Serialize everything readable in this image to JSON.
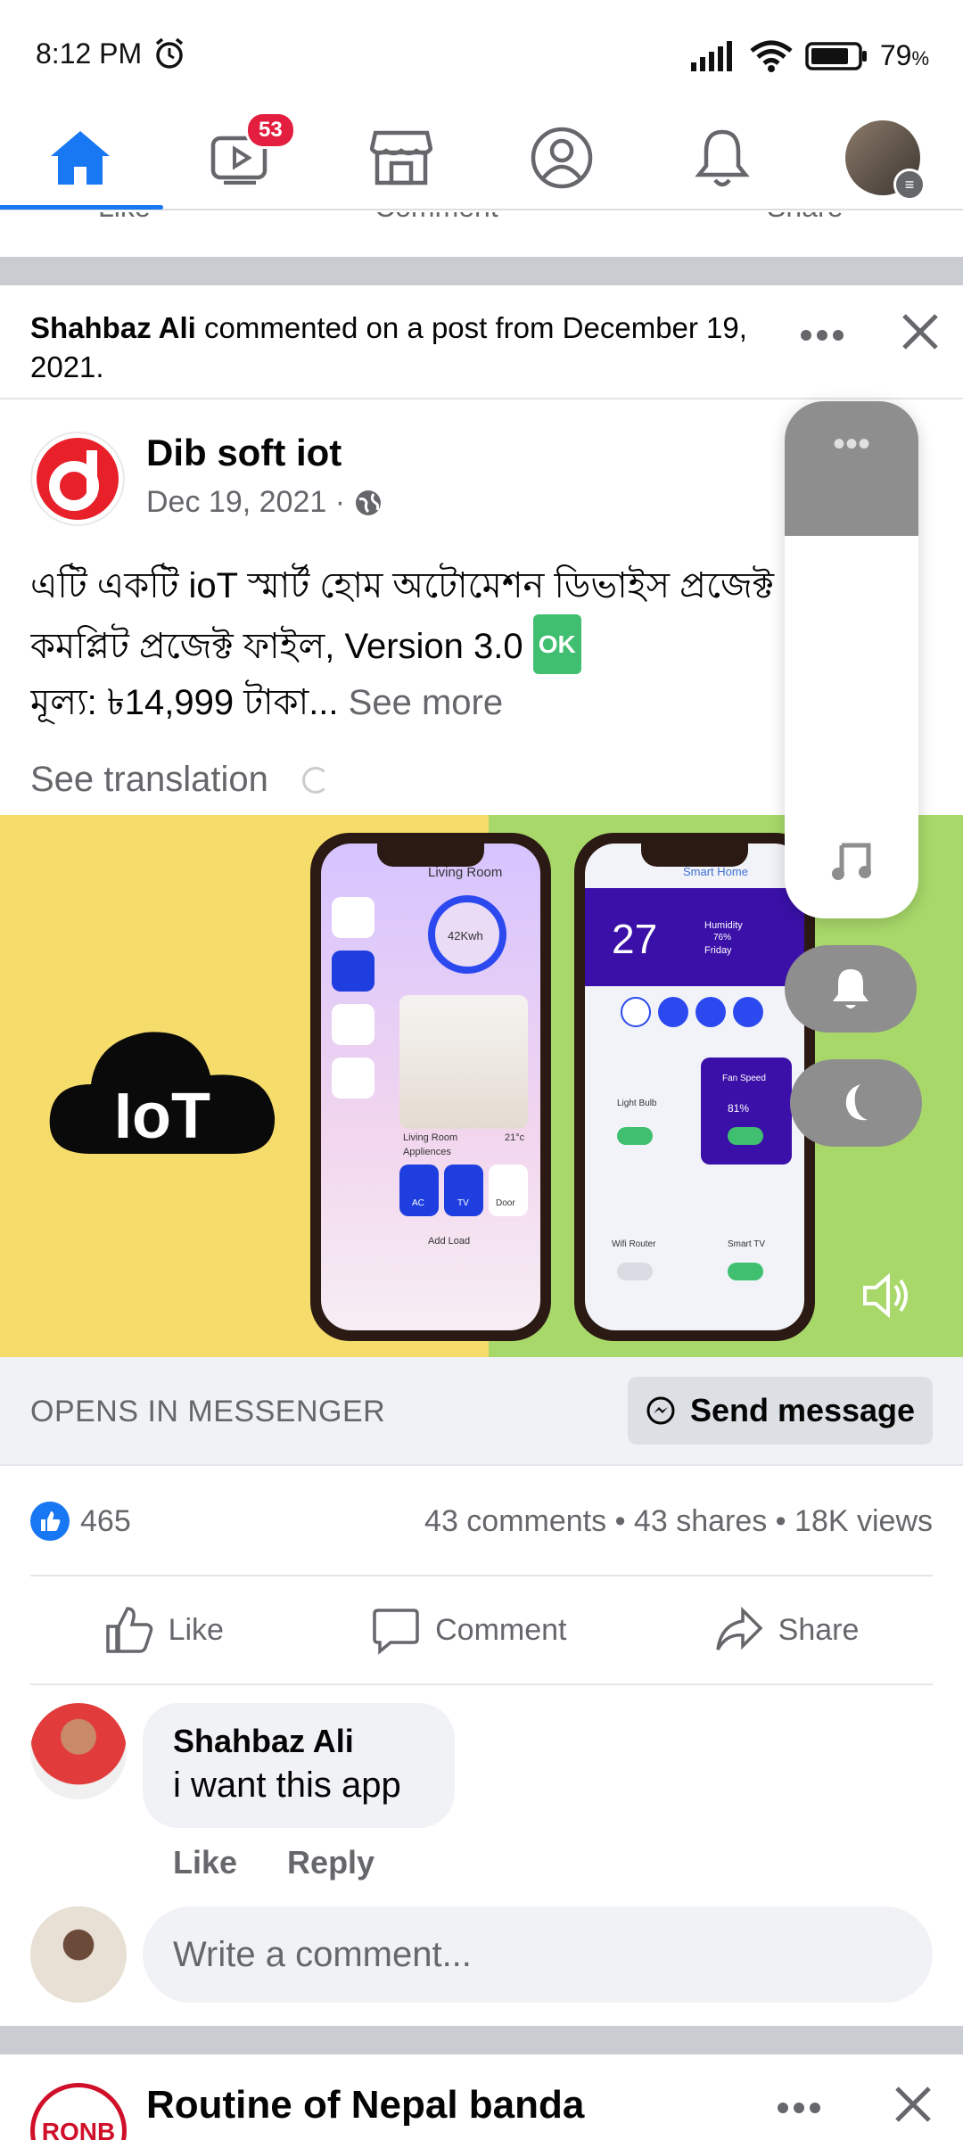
{
  "status_bar": {
    "time": "8:12 PM",
    "battery": "79",
    "battery_pct_symbol": "%"
  },
  "top_nav": {
    "video_badge": "53"
  },
  "prev_post": {
    "like": "Like",
    "comment": "Comment",
    "share": "Share"
  },
  "notice": {
    "actor": "Shahbaz Ali",
    "text": " commented on a post from December 19, 2021."
  },
  "post": {
    "page_name": "Dib soft iot",
    "date": "Dec 19, 2021 ·",
    "line1": "এটি একটি ioT স্মার্ট হোম অটোমেশন ডিভাইস প্রজেক্ট",
    "line2": "কমপ্লিট প্রজেক্ট ফাইল, Version 3.0",
    "ok_badge": "OK",
    "line3": "মূল্য: ৳14,999 টাকা...",
    "see_more": " See more",
    "see_translation": "See translation",
    "media": {
      "cloud_label": "IoT",
      "phone1": {
        "title": "Living Room",
        "power": "42Kwh",
        "room_label": "Living Room",
        "temp": "21°c",
        "appliances": "Appliences",
        "ac": "AC",
        "tv": "TV",
        "door": "Door",
        "add_load": "Add Load"
      },
      "phone2": {
        "title": "Smart Home",
        "temp": "27",
        "humidity": "Humidity",
        "humidity_value": "76%",
        "day": "Friday",
        "light_bulb": "Light Bulb",
        "fan_speed": "Fan Speed",
        "fan_value": "81%",
        "wifi_router": "Wifi Router",
        "smart_tv": "Smart TV"
      }
    },
    "cta_label": "OPENS IN MESSENGER",
    "cta_button": "Send message",
    "reaction_count": "465",
    "stats": "43 comments • 43 shares • 18K views",
    "actions": {
      "like": "Like",
      "comment": "Comment",
      "share": "Share"
    }
  },
  "comment": {
    "author": "Shahbaz Ali",
    "text": "i want this app",
    "like": "Like",
    "reply": "Reply"
  },
  "composer": {
    "placeholder": "Write a comment..."
  },
  "next_post": {
    "logo_text": "RONB",
    "title": "Routine of Nepal banda"
  },
  "volume_overlay": {
    "level": 0.74,
    "ring_mode": "bell",
    "dnd_mode": "moon"
  },
  "colors": {
    "brand_blue": "#1877f2",
    "badge_red": "#e41e3f",
    "ok_green": "#3fbf6f",
    "overlay_gray": "#8e8e8e"
  }
}
